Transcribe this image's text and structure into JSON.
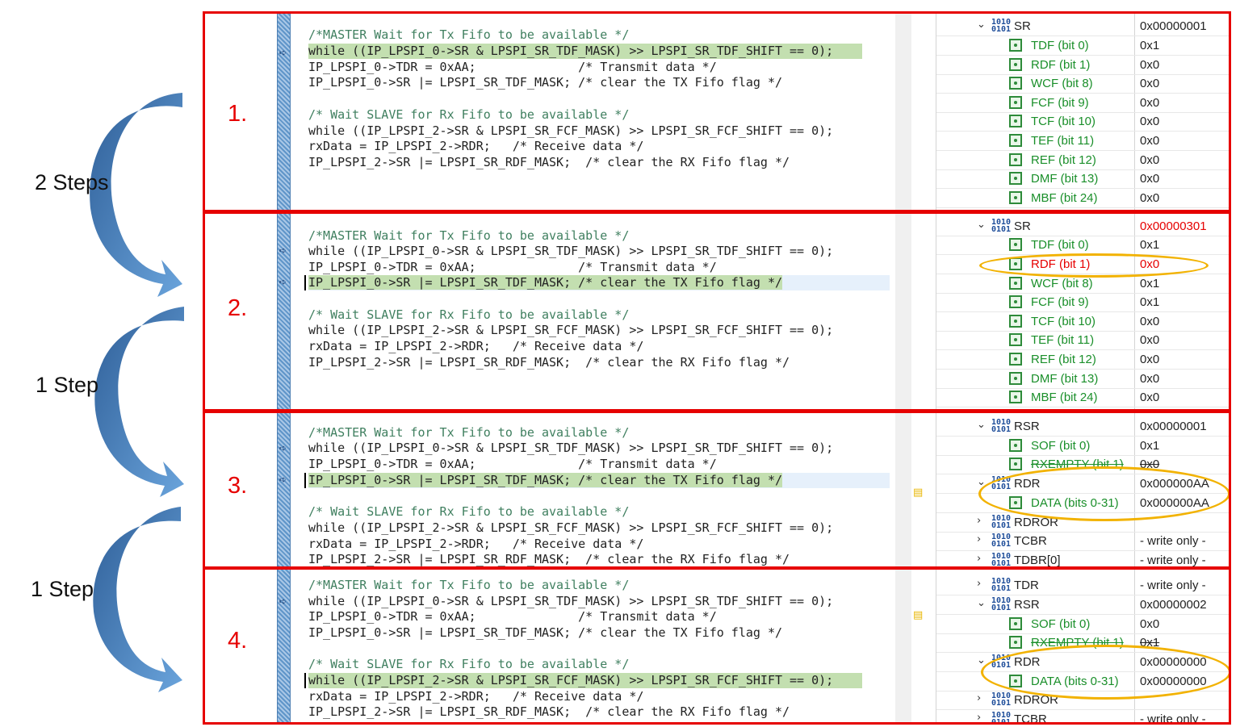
{
  "step_labels": [
    "2 Steps",
    "1 Step",
    "1 Step"
  ],
  "panels": [
    {
      "number": "1.",
      "code": [
        "/*MASTER Wait for Tx Fifo to be available */",
        "while ((IP_LPSPI_0->SR & LPSPI_SR_TDF_MASK) >> LPSPI_SR_TDF_SHIFT == 0);",
        "IP_LPSPI_0->TDR = 0xAA;              /* Transmit data */",
        "IP_LPSPI_0->SR |= LPSPI_SR_TDF_MASK; /* clear the TX Fifo flag */",
        "",
        "/* Wait SLAVE for Rx Fifo to be available */",
        "while ((IP_LPSPI_2->SR & LPSPI_SR_FCF_MASK) >> LPSPI_SR_FCF_SHIFT == 0);",
        "rxData = IP_LPSPI_2->RDR;   /* Receive data */",
        "IP_LPSPI_2->SR |= LPSPI_SR_RDF_MASK;  /* clear the RX Fifo flag */"
      ],
      "registers": [
        {
          "name": "SR",
          "value": "0x00000001"
        },
        {
          "name": "TDF (bit 0)",
          "value": "0x1"
        },
        {
          "name": "RDF (bit 1)",
          "value": "0x0"
        },
        {
          "name": "WCF (bit 8)",
          "value": "0x0"
        },
        {
          "name": "FCF (bit 9)",
          "value": "0x0"
        },
        {
          "name": "TCF (bit 10)",
          "value": "0x0"
        },
        {
          "name": "TEF (bit 11)",
          "value": "0x0"
        },
        {
          "name": "REF (bit 12)",
          "value": "0x0"
        },
        {
          "name": "DMF (bit 13)",
          "value": "0x0"
        },
        {
          "name": "MBF (bit 24)",
          "value": "0x0"
        }
      ]
    },
    {
      "number": "2.",
      "code": [
        "/*MASTER Wait for Tx Fifo to be available */",
        "while ((IP_LPSPI_0->SR & LPSPI_SR_TDF_MASK) >> LPSPI_SR_TDF_SHIFT == 0);",
        "IP_LPSPI_0->TDR = 0xAA;              /* Transmit data */",
        "IP_LPSPI_0->SR |= LPSPI_SR_TDF_MASK; /* clear the TX Fifo flag */",
        "",
        "/* Wait SLAVE for Rx Fifo to be available */",
        "while ((IP_LPSPI_2->SR & LPSPI_SR_FCF_MASK) >> LPSPI_SR_FCF_SHIFT == 0);",
        "rxData = IP_LPSPI_2->RDR;   /* Receive data */",
        "IP_LPSPI_2->SR |= LPSPI_SR_RDF_MASK;  /* clear the RX Fifo flag */"
      ],
      "registers": [
        {
          "name": "SR",
          "value": "0x00000301"
        },
        {
          "name": "TDF (bit 0)",
          "value": "0x1"
        },
        {
          "name": "RDF (bit 1)",
          "value": "0x0"
        },
        {
          "name": "WCF (bit 8)",
          "value": "0x1"
        },
        {
          "name": "FCF (bit 9)",
          "value": "0x1"
        },
        {
          "name": "TCF (bit 10)",
          "value": "0x0"
        },
        {
          "name": "TEF (bit 11)",
          "value": "0x0"
        },
        {
          "name": "REF (bit 12)",
          "value": "0x0"
        },
        {
          "name": "DMF (bit 13)",
          "value": "0x0"
        },
        {
          "name": "MBF (bit 24)",
          "value": "0x0"
        }
      ]
    },
    {
      "number": "3.",
      "code": [
        "/*MASTER Wait for Tx Fifo to be available */",
        "while ((IP_LPSPI_0->SR & LPSPI_SR_TDF_MASK) >> LPSPI_SR_TDF_SHIFT == 0);",
        "IP_LPSPI_0->TDR = 0xAA;              /* Transmit data */",
        "IP_LPSPI_0->SR |= LPSPI_SR_TDF_MASK; /* clear the TX Fifo flag */",
        "",
        "/* Wait SLAVE for Rx Fifo to be available */",
        "while ((IP_LPSPI_2->SR & LPSPI_SR_FCF_MASK) >> LPSPI_SR_FCF_SHIFT == 0);",
        "rxData = IP_LPSPI_2->RDR;   /* Receive data */",
        "IP_LPSPI_2->SR |= LPSPI_SR_RDF_MASK;  /* clear the RX Fifo flag */"
      ],
      "registers": [
        {
          "name": "RSR",
          "value": "0x00000001"
        },
        {
          "name": "SOF (bit 0)",
          "value": "0x1"
        },
        {
          "name": "RXEMPTY (bit 1)",
          "value": "0x0"
        },
        {
          "name": "RDR",
          "value": "0x000000AA"
        },
        {
          "name": "DATA (bits 0-31)",
          "value": "0x000000AA"
        },
        {
          "name": "RDROR",
          "value": ""
        },
        {
          "name": "TCBR",
          "value": "- write only -"
        },
        {
          "name": "TDBR[0]",
          "value": "- write only -"
        }
      ]
    },
    {
      "number": "4.",
      "code": [
        "/*MASTER Wait for Tx Fifo to be available */",
        "while ((IP_LPSPI_0->SR & LPSPI_SR_TDF_MASK) >> LPSPI_SR_TDF_SHIFT == 0);",
        "IP_LPSPI_0->TDR = 0xAA;              /* Transmit data */",
        "IP_LPSPI_0->SR |= LPSPI_SR_TDF_MASK; /* clear the TX Fifo flag */",
        "",
        "/* Wait SLAVE for Rx Fifo to be available */",
        "while ((IP_LPSPI_2->SR & LPSPI_SR_FCF_MASK) >> LPSPI_SR_FCF_SHIFT == 0);",
        "rxData = IP_LPSPI_2->RDR;   /* Receive data */",
        "IP_LPSPI_2->SR |= LPSPI_SR_RDF_MASK;  /* clear the RX Fifo flag */"
      ],
      "registers": [
        {
          "name": "TDR",
          "value": "- write only -"
        },
        {
          "name": "RSR",
          "value": "0x00000002"
        },
        {
          "name": "SOF (bit 0)",
          "value": "0x0"
        },
        {
          "name": "RXEMPTY (bit 1)",
          "value": "0x1"
        },
        {
          "name": "RDR",
          "value": "0x00000000"
        },
        {
          "name": "DATA (bits 0-31)",
          "value": "0x00000000"
        },
        {
          "name": "RDROR",
          "value": ""
        },
        {
          "name": "TCBR",
          "value": "- write only -"
        }
      ]
    }
  ],
  "colors": {
    "frame": "#e60000",
    "highlight": "#c3dfb0",
    "ellipse": "#f2b200",
    "arrow": "#3f78b8"
  }
}
